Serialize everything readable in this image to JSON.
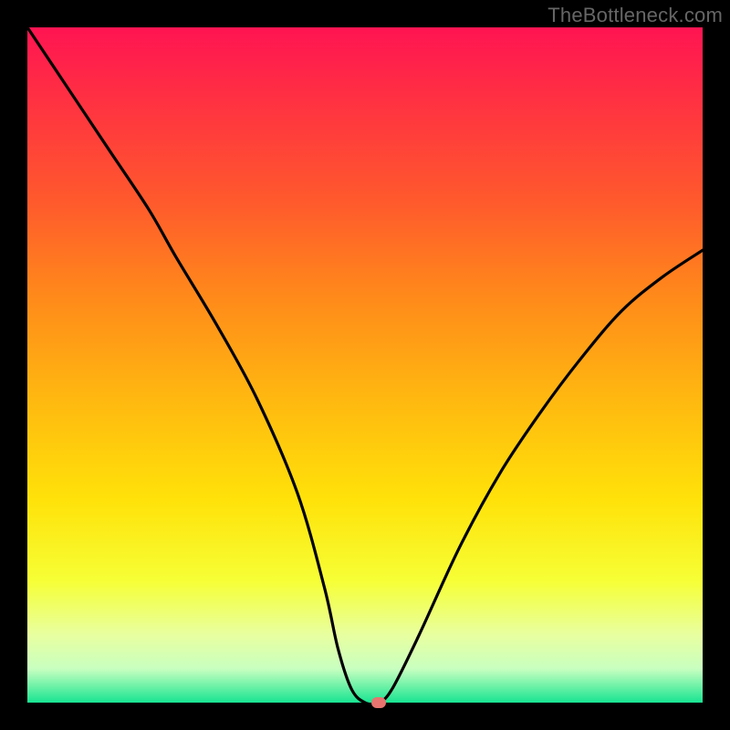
{
  "watermark": "TheBottleneck.com",
  "colors": {
    "gradient_stops": [
      {
        "pos": 0.0,
        "color": "#ff1452"
      },
      {
        "pos": 0.12,
        "color": "#ff3440"
      },
      {
        "pos": 0.26,
        "color": "#ff5a2c"
      },
      {
        "pos": 0.4,
        "color": "#ff8a1a"
      },
      {
        "pos": 0.55,
        "color": "#ffb810"
      },
      {
        "pos": 0.7,
        "color": "#ffe209"
      },
      {
        "pos": 0.82,
        "color": "#f6ff36"
      },
      {
        "pos": 0.9,
        "color": "#e8ffa0"
      },
      {
        "pos": 0.95,
        "color": "#c8ffc0"
      },
      {
        "pos": 0.975,
        "color": "#70f2a8"
      },
      {
        "pos": 1.0,
        "color": "#18e492"
      }
    ],
    "curve": "#000000",
    "marker": "#e7746f",
    "frame": "#000000"
  },
  "chart_data": {
    "type": "line",
    "title": "",
    "xlabel": "",
    "ylabel": "",
    "xlim": [
      0,
      100
    ],
    "ylim": [
      0,
      100
    ],
    "x": [
      0,
      6,
      12,
      18,
      22,
      28,
      34,
      40,
      44,
      46,
      48,
      50,
      52,
      54,
      58,
      64,
      70,
      76,
      82,
      88,
      94,
      100
    ],
    "values": [
      100,
      91,
      82,
      73,
      66,
      56,
      45,
      31,
      17,
      8,
      2,
      0,
      0,
      2,
      10,
      23,
      34,
      43,
      51,
      58,
      63,
      67
    ],
    "marker": {
      "x": 52,
      "y": 0
    }
  }
}
